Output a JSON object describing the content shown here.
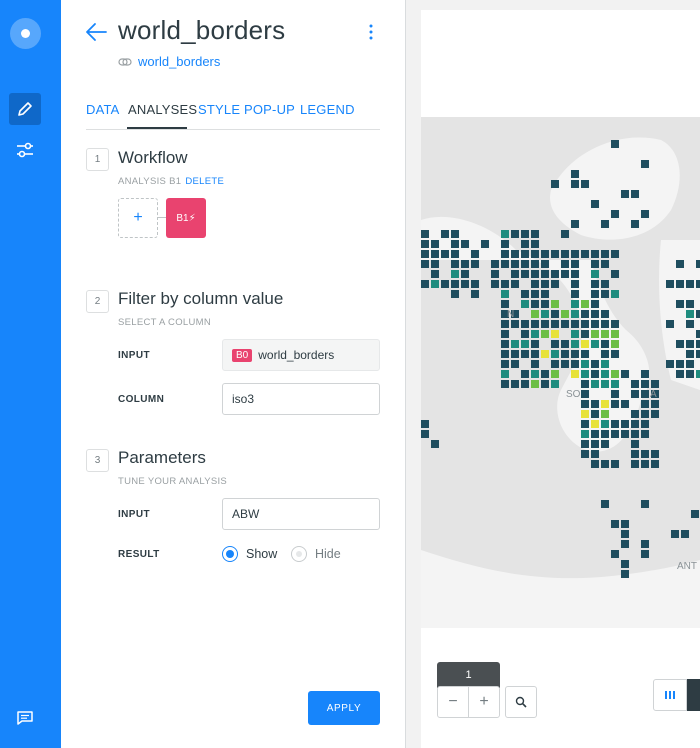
{
  "editor": {
    "title": "world_borders",
    "source_name": "world_borders",
    "tabs": [
      "DATA",
      "ANALYSES",
      "STYLE",
      "POP-UP",
      "LEGEND"
    ],
    "active_tab": "ANALYSES"
  },
  "workflow": {
    "step": "1",
    "title": "Workflow",
    "subtitle": "ANALYSIS B1",
    "delete_label": "DELETE",
    "add_symbol": "+",
    "node_label": "B1⚡"
  },
  "filter": {
    "step": "2",
    "title": "Filter by column value",
    "subtitle": "SELECT A COLUMN",
    "input_label": "INPUT",
    "input_badge": "B0",
    "input_value": "world_borders",
    "column_label": "COLUMN",
    "column_value": "iso3"
  },
  "parameters": {
    "step": "3",
    "title": "Parameters",
    "subtitle": "TUNE YOUR ANALYSIS",
    "input_label": "INPUT",
    "input_value": "ABW",
    "result_label": "RESULT",
    "result_options": [
      "Show",
      "Hide"
    ],
    "result_selected": "Show"
  },
  "footer": {
    "apply_label": "APPLY"
  },
  "map": {
    "zoom_level": "1",
    "zoom_out": "−",
    "zoom_in": "+",
    "labels": [
      "N",
      "SO",
      "A",
      "ANT"
    ]
  },
  "colors": {
    "brand_blue": "#1785FB",
    "analysis_pink": "#E9436F",
    "grid_dark": "#1F4E5F",
    "grid_teal": "#1E8C7E",
    "grid_green": "#6CBE45",
    "grid_yellow": "#E7E238"
  }
}
